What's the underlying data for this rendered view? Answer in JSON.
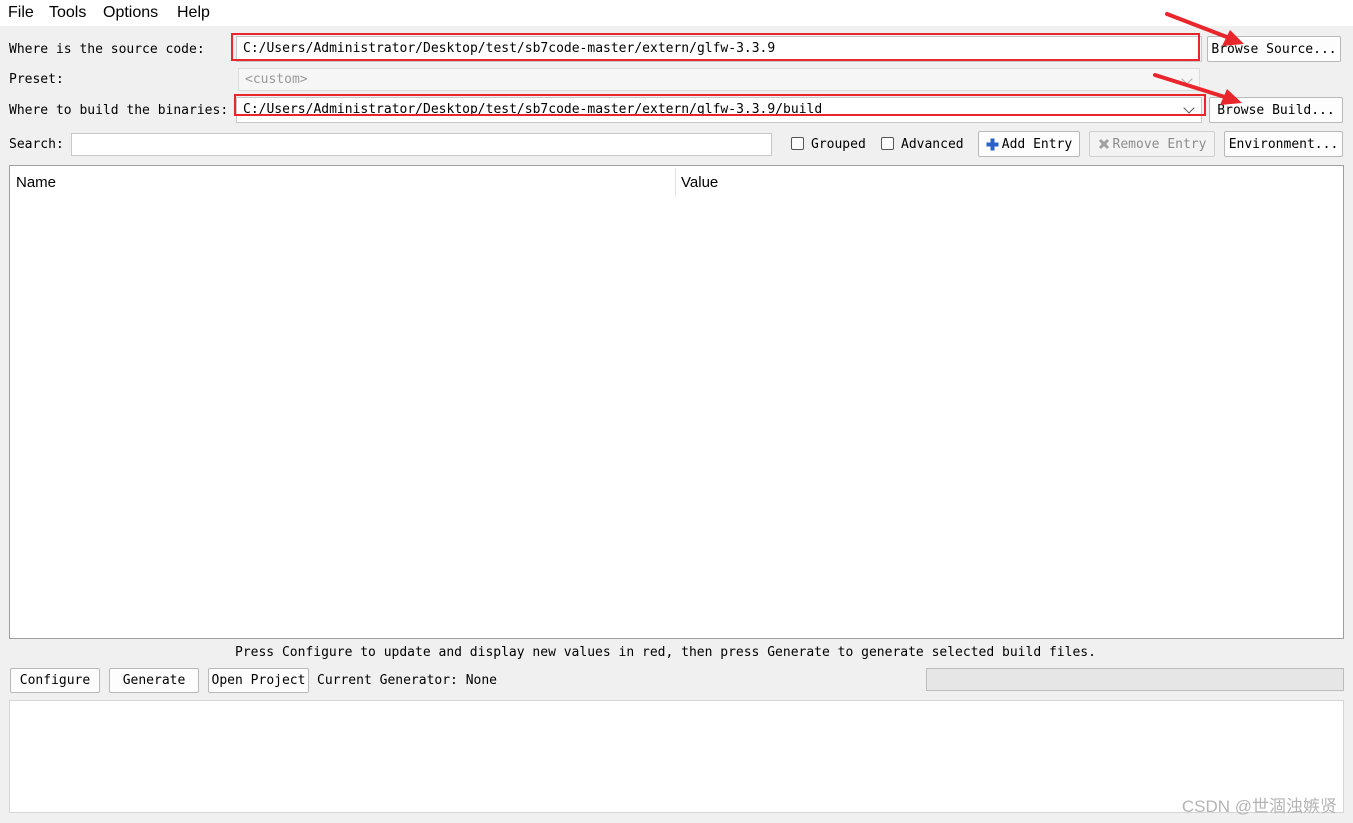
{
  "menu": [
    "File",
    "Tools",
    "Options",
    "Help"
  ],
  "source": {
    "label": "Where is the source code:",
    "value": "C:/Users/Administrator/Desktop/test/sb7code-master/extern/glfw-3.3.9",
    "browse_label": "Browse Source..."
  },
  "preset": {
    "label": "Preset:",
    "value": "<custom>"
  },
  "build": {
    "label": "Where to build the binaries:",
    "value": "C:/Users/Administrator/Desktop/test/sb7code-master/extern/glfw-3.3.9/build",
    "browse_label": "Browse Build..."
  },
  "search": {
    "label": "Search:",
    "value": ""
  },
  "options": {
    "grouped_label": "Grouped",
    "grouped_checked": false,
    "advanced_label": "Advanced",
    "advanced_checked": false,
    "add_entry_label": "Add Entry",
    "remove_entry_label": "Remove Entry",
    "environment_label": "Environment..."
  },
  "table": {
    "columns": [
      "Name",
      "Value"
    ],
    "rows": []
  },
  "hint": "Press Configure to update and display new values in red, then press Generate to generate selected build files.",
  "actions": {
    "configure_label": "Configure",
    "generate_label": "Generate",
    "open_project_label": "Open Project",
    "current_generator": "Current Generator: None"
  },
  "progress": 0,
  "watermark": "CSDN @世涸浊嫉贤",
  "colors": {
    "annotation_red": "#e8262b",
    "add_icon_blue": "#2a62c9",
    "remove_icon_gray": "#a0a0a0"
  }
}
